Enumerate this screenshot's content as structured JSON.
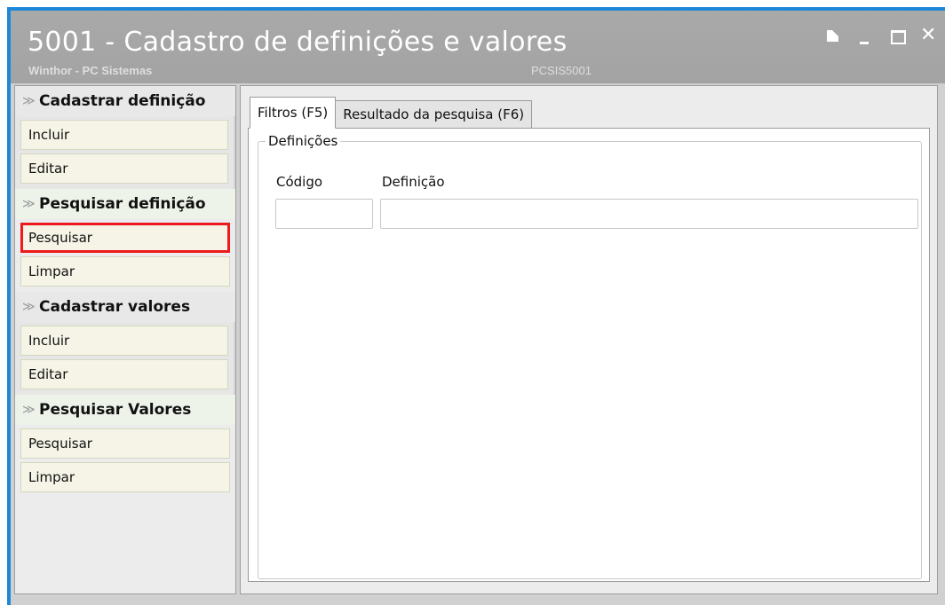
{
  "window": {
    "title": "5001 - Cadastro de definições e valores",
    "subtitle": "Winthor - PC Sistemas",
    "module_code": "PCSIS5001",
    "close_glyph": "✕"
  },
  "sidebar": {
    "groups": [
      {
        "title": "Cadastrar definição",
        "items": [
          "Incluir",
          "Editar"
        ]
      },
      {
        "title": "Pesquisar definição",
        "items": [
          "Pesquisar",
          "Limpar"
        ]
      },
      {
        "title": "Cadastrar valores",
        "items": [
          "Incluir",
          "Editar"
        ]
      },
      {
        "title": "Pesquisar Valores",
        "items": [
          "Pesquisar",
          "Limpar"
        ]
      }
    ],
    "chevron": "≫"
  },
  "tabs": [
    {
      "label": "Filtros (F5)",
      "active": true
    },
    {
      "label": "Resultado da pesquisa (F6)",
      "active": false
    }
  ],
  "filters": {
    "group_title": "Definições",
    "codigo_label": "Código",
    "codigo_value": "",
    "definicao_label": "Definição",
    "definicao_value": ""
  },
  "colors": {
    "window_border": "#1e88d8",
    "titlebar": "#a6a6a6",
    "highlight": "#ec1a1a",
    "item_bg": "#f5f4e6"
  }
}
